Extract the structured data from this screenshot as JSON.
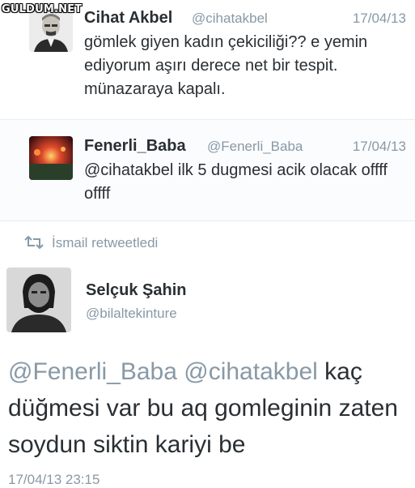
{
  "watermark": "GULDUM.NET",
  "tweets": [
    {
      "name": "Cihat Akbel",
      "handle": "@cihatakbel",
      "date": "17/04/13",
      "text": "gömlek giyen kadın çekiciliği?? e yemin ediyorum aşırı derece net bir tespit. münazaraya kapalı."
    },
    {
      "name": "Fenerli_Baba",
      "handle": "@Fenerli_Baba",
      "date": "17/04/13",
      "text": "@cihatakbel ilk 5 dugmesi acik olacak offff offff"
    }
  ],
  "retweet": {
    "label": "İsmail retweetledi",
    "icon": "retweet-icon"
  },
  "main_tweet": {
    "name": "Selçuk Şahin",
    "handle": "@bilaltekinture",
    "mention1": "@Fenerli_Baba",
    "mention2": "@cihatakbel",
    "text": "kaç düğmesi var bu aq gomleginin zaten soydun siktin kariyi be",
    "timestamp": "17/04/13 23:15"
  },
  "colors": {
    "text": "#292f33",
    "muted": "#8899a6",
    "divider": "#e6ecf0"
  }
}
